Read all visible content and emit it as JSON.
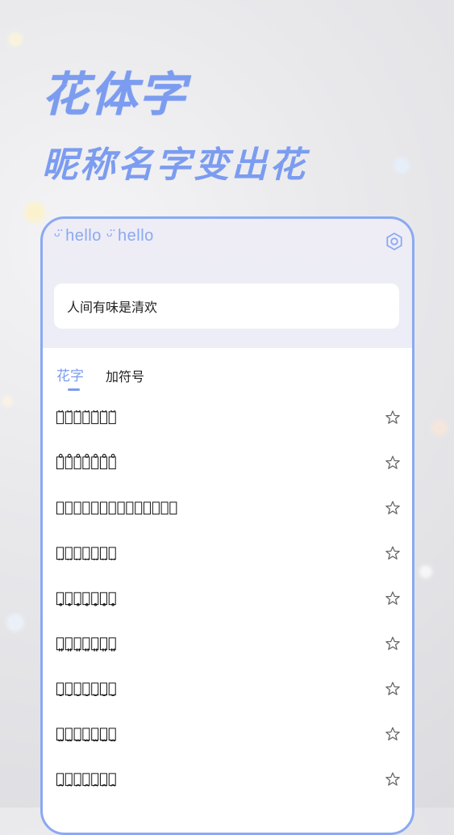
{
  "hero": {
    "title": "花体字",
    "subtitle": "昵称名字变出花"
  },
  "app": {
    "brand": "ᵕ̈ hello ᵕ̈ hello",
    "input_value": "人间有味是清欢",
    "tabs": [
      {
        "label": "花字",
        "active": true
      },
      {
        "label": "加符号",
        "active": false
      }
    ],
    "results": [
      "人̆间̆有̆味̆是̆清̆欢̆",
      "人̊间̊有̊味̊是̊清̊欢̊",
      "人ͦ间ͦ有ͦ味ͦ是ͦ清ͦ欢ͦ",
      "人̤间̤有̤味̤是̤清̤欢̤",
      "人̥间̥有̥味̥是̥清̥欢̥",
      "人͈间͈有͈味͈是͈清͈欢͈",
      "人̮间̮有̮味̮是̮清̮欢̮",
      "人̫间̫有̫味̫是̫清̫欢̫",
      "人̯间̯有̯味̯是̯清̯欢̯"
    ]
  },
  "colors": {
    "accent": "#7b9cf0",
    "frame": "#8aa9f2"
  },
  "icons": {
    "settings": "settings-icon",
    "favorite": "star-icon"
  }
}
